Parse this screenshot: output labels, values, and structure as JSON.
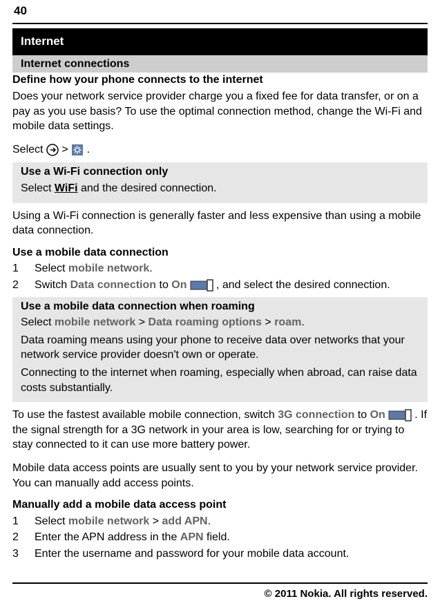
{
  "pageNumber": "40",
  "header": {
    "title": "Internet",
    "subsection": "Internet connections",
    "topic": "Define how your phone connects to the internet"
  },
  "intro": "Does your network service provider charge you a fixed fee for data transfer, or on a pay as you use basis? To use the optimal connection method, change the Wi-Fi and mobile data settings.",
  "select": {
    "prefix": "Select ",
    "mid": " > ",
    "suffix": "."
  },
  "wifiOnly": {
    "title": "Use a Wi-Fi connection only",
    "textPrefix": "Select ",
    "wifi": "WiFi",
    "textSuffix": " and the desired connection."
  },
  "wifiNote": "Using a Wi-Fi connection is generally faster and less expensive than using a mobile data connection.",
  "mobileData": {
    "title": "Use a mobile data connection",
    "step1a": "Select ",
    "step1b": "mobile network",
    "step1c": ".",
    "step2a": "Switch ",
    "step2b": "Data connection",
    "step2c": " to ",
    "step2on": "On",
    "step2d": ", and select the desired connection."
  },
  "roaming": {
    "title": "Use a mobile data connection when roaming",
    "line1a": "Select ",
    "line1b": "mobile network",
    "line1c": " > ",
    "line1d": "Data roaming options",
    "line1e": " > ",
    "line1f": "roam",
    "line1g": ".",
    "line2": "Data roaming means using your phone to receive data over networks that your network service provider doesn't own or operate.",
    "line3": "Connecting to the internet when roaming, especially when abroad, can raise data costs substantially."
  },
  "fastest": {
    "a": "To use the fastest available mobile connection, switch ",
    "b": "3G connection",
    "c": " to ",
    "on": "On",
    "d": ". If the signal strength for a 3G network in your area is low, searching for or trying to stay connected to it can use more battery power."
  },
  "apnNote": "Mobile data access points are usually sent to you by your network service provider. You can manually add access points.",
  "manualApn": {
    "title": "Manually add a mobile data access point",
    "step1a": "Select ",
    "step1b": "mobile network",
    "step1c": " > ",
    "step1d": "add APN",
    "step1e": ".",
    "step2a": "Enter the APN address in the ",
    "step2b": "APN",
    "step2c": " field.",
    "step3": "Enter the username and password for your mobile data account."
  },
  "footer": "© 2011 Nokia. All rights reserved."
}
